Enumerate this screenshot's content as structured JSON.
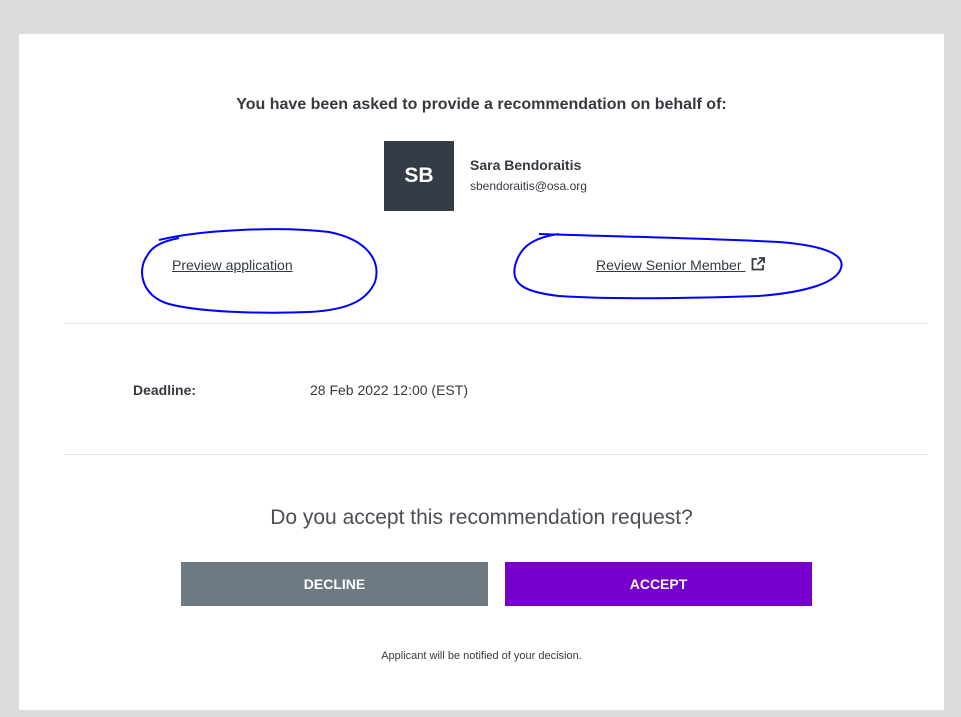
{
  "intro": {
    "text": "You have been asked to provide a recommendation on behalf of:"
  },
  "applicant": {
    "initials": "SB",
    "name": "Sara Bendoraitis",
    "email": "sbendoraitis@osa.org"
  },
  "links": {
    "preview": "Preview application",
    "review": "Review Senior Member"
  },
  "deadline": {
    "label": "Deadline:",
    "value": "28 Feb 2022 12:00 (EST)"
  },
  "question": "Do you accept this recommendation request?",
  "actions": {
    "decline": "DECLINE",
    "accept": "ACCEPT"
  },
  "note": "Applicant will be notified of your decision.",
  "icons": {
    "external_link": "external-link-icon"
  },
  "colors": {
    "avatar_bg": "#343d47",
    "decline_bg": "#6e7a82",
    "accept_bg": "#7700cc",
    "annotation": "#0000ff"
  }
}
